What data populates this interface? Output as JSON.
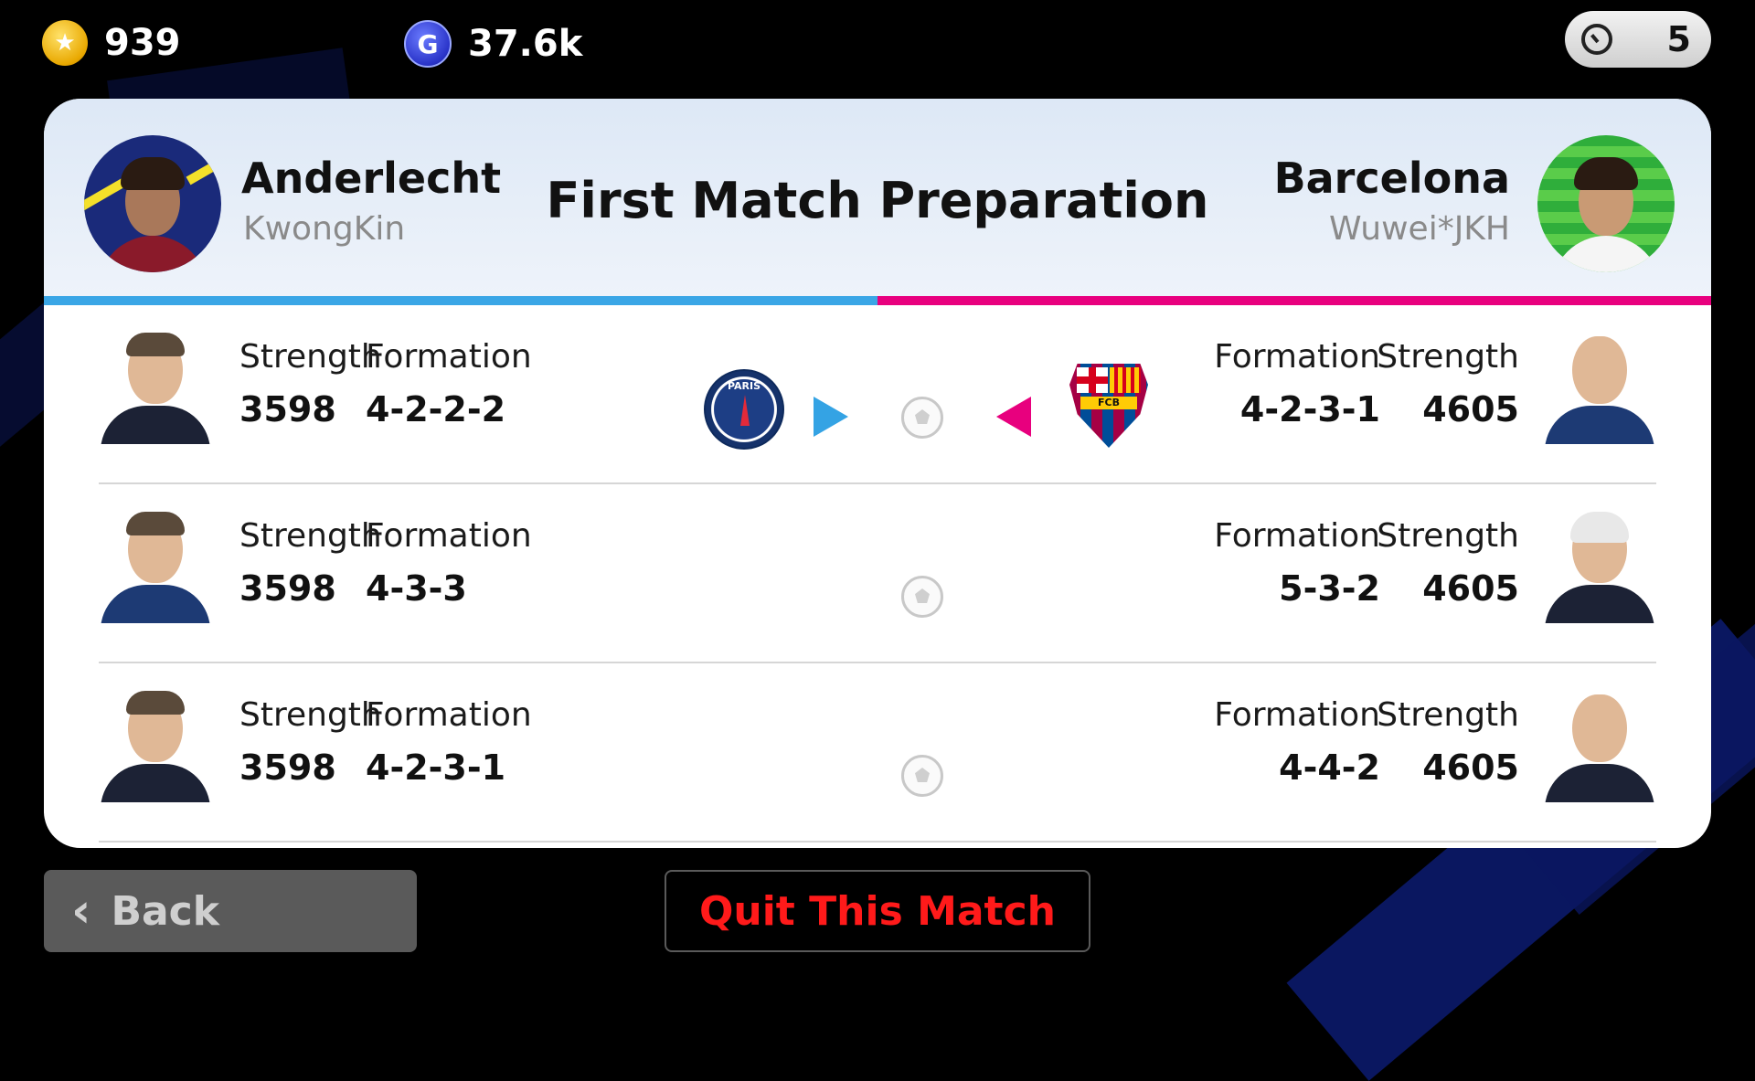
{
  "status_bar": {
    "coins": "939",
    "gp": "37.6k",
    "gp_icon_letter": "G",
    "timer_value": "5"
  },
  "header": {
    "title": "First Match Preparation",
    "home": {
      "team": "Anderlecht",
      "user": "KwongKin"
    },
    "away": {
      "team": "Barcelona",
      "user": "Wuwei*JKH"
    }
  },
  "rows": [
    {
      "home": {
        "strength_label": "Strength",
        "strength": "3598",
        "formation_label": "Formation",
        "formation": "4-2-2-2"
      },
      "away": {
        "strength_label": "Strength",
        "strength": "4605",
        "formation_label": "Formation",
        "formation": "4-2-3-1"
      }
    },
    {
      "home": {
        "strength_label": "Strength",
        "strength": "3598",
        "formation_label": "Formation",
        "formation": "4-3-3"
      },
      "away": {
        "strength_label": "Strength",
        "strength": "4605",
        "formation_label": "Formation",
        "formation": "5-3-2"
      }
    },
    {
      "home": {
        "strength_label": "Strength",
        "strength": "3598",
        "formation_label": "Formation",
        "formation": "4-2-3-1"
      },
      "away": {
        "strength_label": "Strength",
        "strength": "4605",
        "formation_label": "Formation",
        "formation": "4-4-2"
      }
    }
  ],
  "badges": {
    "psg_text": "PARIS",
    "fcb_text": "FCB"
  },
  "buttons": {
    "back": "Back",
    "quit": "Quit This Match"
  },
  "icons": [
    "coin-icon",
    "gp-icon",
    "timer-icon",
    "soccer-ball-icon",
    "arrow-right-icon",
    "arrow-left-icon",
    "back-chevron-icon"
  ],
  "colors": {
    "home_accent": "#3aa6e6",
    "away_accent": "#e8007e",
    "quit_text": "#ff1a1a"
  }
}
